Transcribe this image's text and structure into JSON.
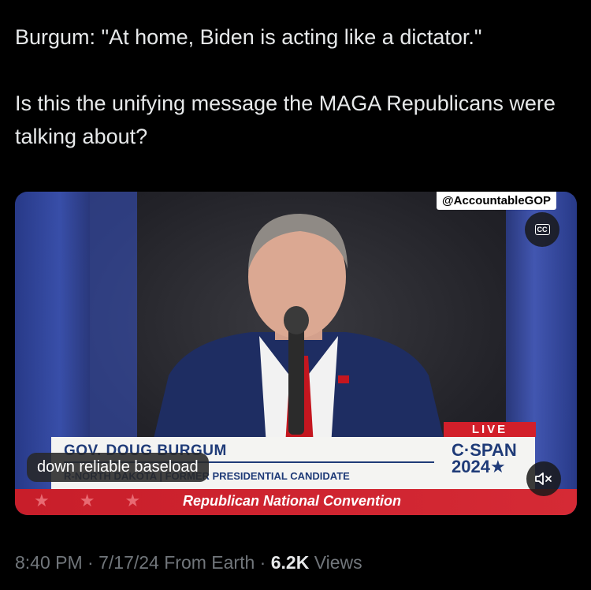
{
  "tweet": {
    "line1": "Burgum: \"At home, Biden is acting like a dictator.\"",
    "line2": "Is this the unifying message the MAGA Republicans were talking about?"
  },
  "video": {
    "watermark": "@AccountableGOP",
    "cc_label": "CC",
    "cc_icon": "closed-captions-icon",
    "mute_icon": "speaker-muted-icon",
    "live_label": "LIVE",
    "lower_third_name": "GOV. DOUG BURGUM",
    "lower_third_title": "R-NORTH DAKOTA | FORMER PRESIDENTIAL CANDIDATE",
    "network_name": "C·SPAN",
    "network_year": "2024★",
    "banner": "Republican National Convention",
    "caption": "down reliable baseload"
  },
  "meta": {
    "time": "8:40 PM",
    "date": "7/17/24",
    "source": "From Earth",
    "views_count": "6.2K",
    "views_label": "Views"
  },
  "colors": {
    "background": "#000000",
    "text": "#e7e9ea",
    "muted_text": "#71767b",
    "live_red": "#d21f2a",
    "cspan_blue": "#1f3b78"
  }
}
